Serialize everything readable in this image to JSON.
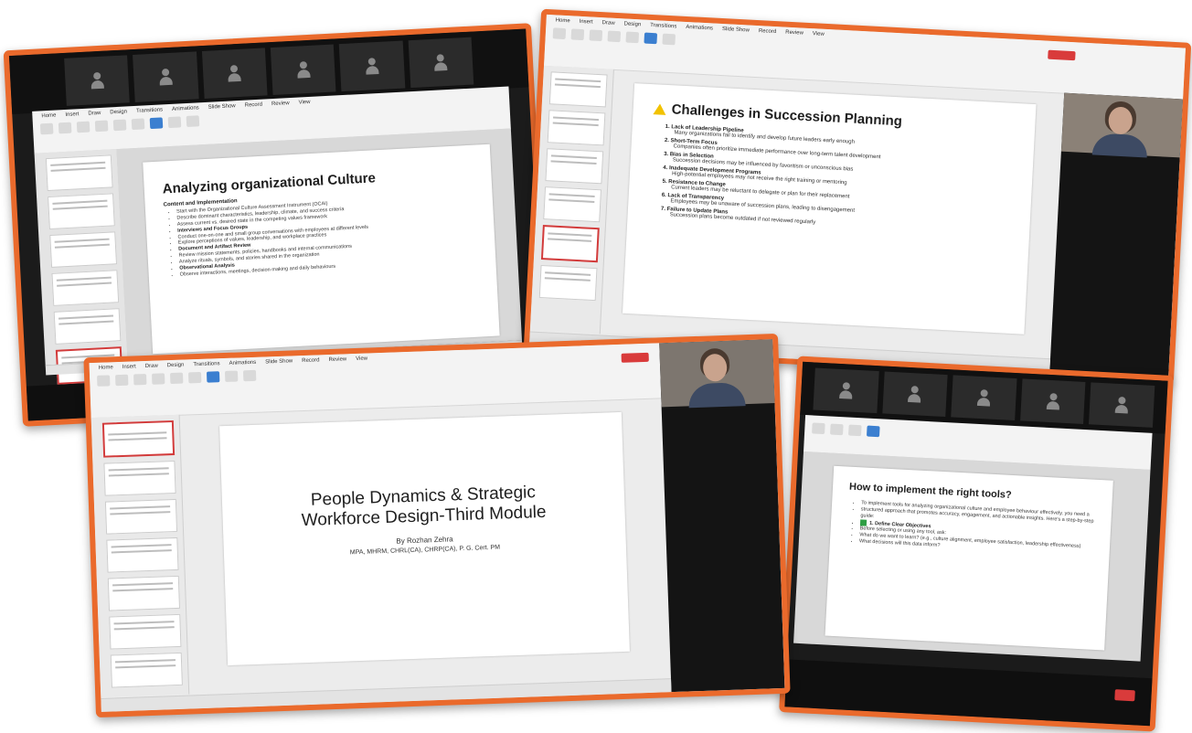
{
  "screens": {
    "s1": {
      "slide_title": "Analyzing organizational Culture",
      "heading": "Content and Implementation",
      "bullets": [
        "Start with the Organizational Culture Assessment Instrument (OCAI)",
        "Describe dominant characteristics, leadership, climate, and success criteria",
        "Assess current vs. desired state in the competing values framework",
        "Interviews and Focus Groups",
        "Conduct one-on-one and small group conversations with employees at different levels",
        "Explore perceptions of values, leadership, and workplace practices",
        "Document and Artifact Review",
        "Review mission statements, policies, handbooks and internal communications",
        "Analyze rituals, symbols, and stories shared in the organization",
        "Observational Analysis",
        "Observe interactions, meetings, decision-making and daily behaviours"
      ]
    },
    "s2": {
      "slide_title": "Challenges in Succession Planning",
      "items": [
        {
          "title": "1. Lack of Leadership Pipeline",
          "desc": "Many organizations fail to identify and develop future leaders early enough"
        },
        {
          "title": "2. Short-Term Focus",
          "desc": "Companies often prioritize immediate performance over long-term talent development"
        },
        {
          "title": "3. Bias in Selection",
          "desc": "Succession decisions may be influenced by favoritism or unconscious bias"
        },
        {
          "title": "4. Inadequate Development Programs",
          "desc": "High-potential employees may not receive the right training or mentoring"
        },
        {
          "title": "5. Resistance to Change",
          "desc": "Current leaders may be reluctant to delegate or plan for their replacement"
        },
        {
          "title": "6. Lack of Transparency",
          "desc": "Employees may be unaware of succession plans, leading to disengagement"
        },
        {
          "title": "7. Failure to Update Plans",
          "desc": "Succession plans become outdated if not reviewed regularly"
        }
      ]
    },
    "s3": {
      "title_line1": "People Dynamics & Strategic",
      "title_line2": "Workforce Design-Third Module",
      "author": "By Rozhan Zehra",
      "credentials": "MPA, MHRM, CHRL(CA), CHRP(CA), P. G. Cert. PM"
    },
    "s4": {
      "slide_title": "How to implement the right tools?",
      "bullets": [
        "To implement tools for analyzing organizational culture and employee behaviour effectively, you need a",
        "structured approach that promotes accuracy, engagement, and actionable insights. Here's a step-by-step guide:",
        "1. Define Clear Objectives",
        "Before selecting or using any tool, ask:",
        "What do we want to learn? (e.g., culture alignment, employee satisfaction, leadership effectiveness)",
        "What decisions will this data inform?"
      ]
    }
  },
  "ribbon_tabs": [
    "Home",
    "Insert",
    "Draw",
    "Design",
    "Transitions",
    "Animations",
    "Slide Show",
    "Record",
    "Review",
    "View"
  ],
  "colors": {
    "frame": "#ea6a2c",
    "zoom_bg": "#1b1b1b",
    "end_button": "#d93b3b"
  }
}
